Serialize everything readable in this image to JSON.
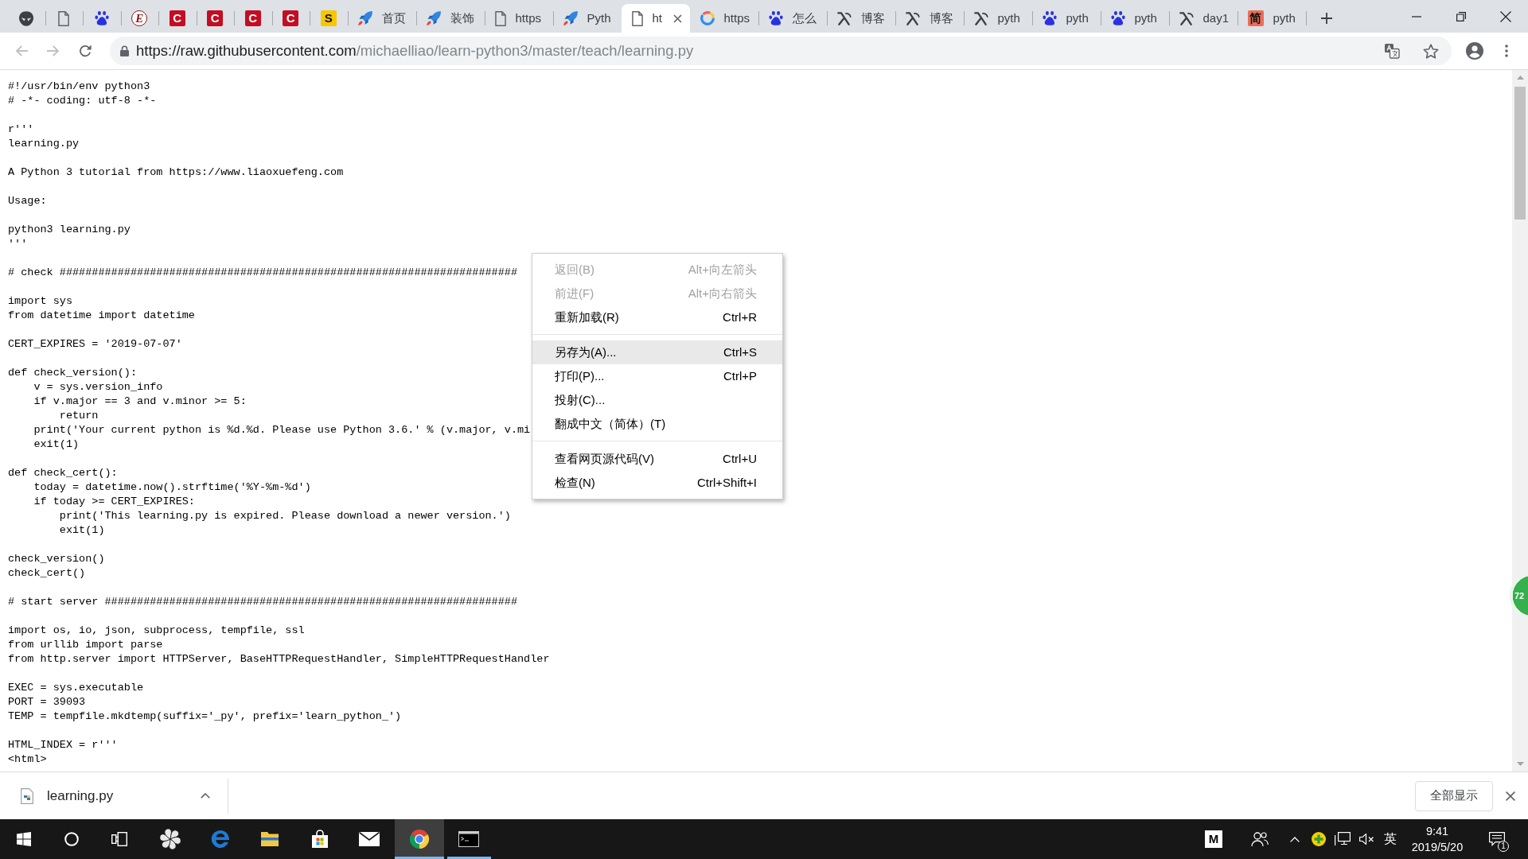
{
  "tabs": [
    {
      "kind": "mask",
      "selected": false
    },
    {
      "kind": "page",
      "selected": false
    },
    {
      "kind": "paw",
      "selected": false
    },
    {
      "kind": "letter",
      "logo_text": "E",
      "color": "#ffffff",
      "selected": false
    },
    {
      "kind": "letter",
      "logo_text": "C",
      "color": "#c30d23",
      "selected": false
    },
    {
      "kind": "letter",
      "logo_text": "C",
      "color": "#c30d23",
      "selected": false
    },
    {
      "kind": "letter",
      "logo_text": "C",
      "color": "#c30d23",
      "selected": false
    },
    {
      "kind": "letter",
      "logo_text": "C",
      "color": "#c30d23",
      "selected": false
    },
    {
      "kind": "letter",
      "logo_text": "S",
      "color": "#f7c600",
      "selected": false
    },
    {
      "kind": "rocket",
      "title": "首页",
      "selected": false
    },
    {
      "kind": "rocket",
      "title": "装饰",
      "selected": false
    },
    {
      "kind": "page",
      "title": "https",
      "selected": false
    },
    {
      "kind": "rocket",
      "title": "Pyth",
      "selected": false
    },
    {
      "kind": "page",
      "title": "ht",
      "selected": true
    },
    {
      "kind": "ring",
      "title": "https",
      "selected": false
    },
    {
      "kind": "paw",
      "title": "怎么",
      "selected": false
    },
    {
      "kind": "lambda",
      "title": "博客",
      "selected": false
    },
    {
      "kind": "lambda",
      "title": "博客",
      "selected": false
    },
    {
      "kind": "lambda",
      "title": "pyth",
      "selected": false
    },
    {
      "kind": "paw",
      "title": "pyth",
      "selected": false
    },
    {
      "kind": "paw",
      "title": "pyth",
      "selected": false
    },
    {
      "kind": "lambda",
      "title": "day1",
      "selected": false
    },
    {
      "kind": "letter",
      "logo_text": "简",
      "color": "#ea6f5a",
      "title": "pyth",
      "selected": false
    }
  ],
  "toolbar": {
    "back": {
      "disabled": true
    },
    "forward": {
      "disabled": true
    },
    "address": {
      "origin": "https://raw.githubusercontent.com",
      "path": "/michaelliao/learn-python3/master/teach/learning.py"
    }
  },
  "code_blocks": [
    [
      "#!/usr/bin/env python3",
      "# -*- coding: utf-8 -*-"
    ],
    [
      "r'''",
      "learning.py"
    ],
    [
      "A Python 3 tutorial from https://www.liaoxuefeng.com"
    ],
    [
      "Usage:"
    ],
    [
      "python3 learning.py",
      "'''"
    ],
    [
      "# check #######################################################################"
    ],
    [
      "import sys",
      "from datetime import datetime"
    ],
    [
      "CERT_EXPIRES = '2019-07-07'"
    ],
    [
      "def check_version():",
      "    v = sys.version_info",
      "    if v.major == 3 and v.minor >= 5:",
      "        return",
      "    print('Your current python is %d.%d. Please use Python 3.6.' % (v.major, v.mi",
      "    exit(1)"
    ],
    [
      "def check_cert():",
      "    today = datetime.now().strftime('%Y-%m-%d')",
      "    if today >= CERT_EXPIRES:",
      "        print('This learning.py is expired. Please download a newer version.')",
      "        exit(1)"
    ],
    [
      "check_version()",
      "check_cert()"
    ],
    [
      "# start server ################################################################"
    ],
    [
      "import os, io, json, subprocess, tempfile, ssl",
      "from urllib import parse",
      "from http.server import HTTPServer, BaseHTTPRequestHandler, SimpleHTTPRequestHandler"
    ],
    [
      "EXEC = sys.executable",
      "PORT = 39093",
      "TEMP = tempfile.mkdtemp(suffix='_py', prefix='learn_python_')"
    ],
    [
      "HTML_INDEX = r'''",
      "<html>"
    ]
  ],
  "context_menu": {
    "groups": [
      [
        {
          "label": "返回(B)",
          "shortcut": "Alt+向左箭头",
          "disabled": true,
          "selected": false
        },
        {
          "label": "前进(F)",
          "shortcut": "Alt+向右箭头",
          "disabled": true,
          "selected": false
        },
        {
          "label": "重新加载(R)",
          "shortcut": "Ctrl+R",
          "disabled": false,
          "selected": false
        }
      ],
      [
        {
          "label": "另存为(A)...",
          "shortcut": "Ctrl+S",
          "disabled": false,
          "selected": true
        },
        {
          "label": "打印(P)...",
          "shortcut": "Ctrl+P",
          "disabled": false,
          "selected": false
        },
        {
          "label": "投射(C)...",
          "disabled": false,
          "selected": false
        },
        {
          "label": "翻成中文（简体）(T)",
          "disabled": false,
          "selected": false
        }
      ],
      [
        {
          "label": "查看网页源代码(V)",
          "shortcut": "Ctrl+U",
          "disabled": false,
          "selected": false
        },
        {
          "label": "检查(N)",
          "shortcut": "Ctrl+Shift+I",
          "disabled": false,
          "selected": false
        }
      ]
    ]
  },
  "side_badge": {
    "text": "72"
  },
  "download_shelf": {
    "items": [
      {
        "file_name": "learning.py"
      }
    ],
    "show_all": "全部显示"
  },
  "taskbar": {
    "items": [
      {
        "kind": "start",
        "selected": false,
        "running": false
      },
      {
        "kind": "search",
        "selected": false,
        "running": false
      },
      {
        "kind": "taskview",
        "selected": false,
        "running": false
      },
      {
        "kind": "swirl",
        "selected": false,
        "running": false
      },
      {
        "kind": "edge",
        "selected": false,
        "running": false
      },
      {
        "kind": "explorer",
        "selected": false,
        "running": false
      },
      {
        "kind": "store",
        "selected": false,
        "running": false
      },
      {
        "kind": "mail",
        "selected": false,
        "running": false
      },
      {
        "kind": "chrome",
        "selected": true,
        "running": true
      },
      {
        "kind": "terminal",
        "selected": false,
        "running": true
      }
    ],
    "tray": {
      "ime": "M",
      "volume_muted": true,
      "language": "英",
      "time": "9:41",
      "date": "2019/5/20",
      "notification_count": "1"
    }
  }
}
